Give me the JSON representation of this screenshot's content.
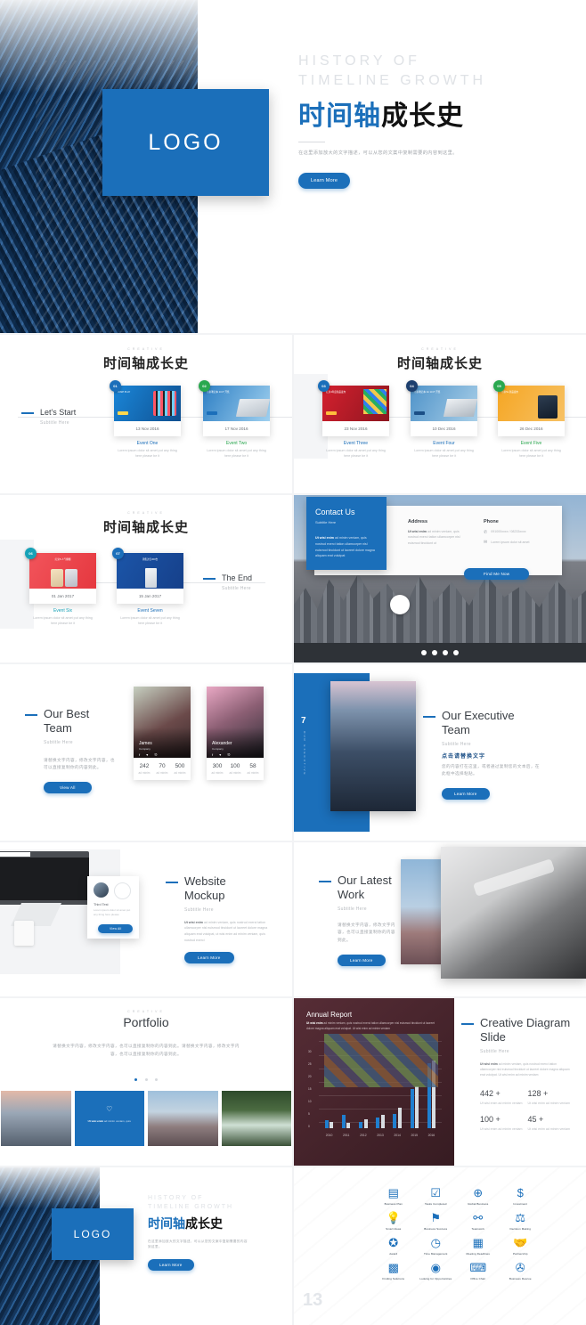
{
  "cover": {
    "en_line1": "HISTORY OF",
    "en_line2": "TIMELINE GROWTH",
    "cn_blue": "时间轴",
    "cn_black": "成长史",
    "desc": "在这里添加放大的文字描述，可以从您的文案中复制需要的内容到这里。",
    "button": "Learn More",
    "logo": "LOGO"
  },
  "timeline1": {
    "kicker": "CREATIVE",
    "title": "时间轴成长史",
    "start_label": "Let's Start",
    "start_sub": "Subtitle Here",
    "events": [
      {
        "num": "01",
        "date": "13 Nov 2016",
        "name": "Event One",
        "desc": "Lorem ipsum dolor sit amet put any thing here please be it",
        "color": "#1b6fba"
      },
      {
        "num": "02",
        "date": "17 Nov 2016",
        "name": "Event Two",
        "desc": "Lorem ipsum dolor sit amet put any thing here please be it",
        "color": "#2aa84f"
      }
    ]
  },
  "timeline2": {
    "kicker": "CREATIVE",
    "title": "时间轴成长史",
    "events": [
      {
        "num": "03",
        "date": "23 Nov 2016",
        "name": "Event Three",
        "desc": "Lorem ipsum dolor sit amet put any thing here please be it",
        "color": "#1b6fba"
      },
      {
        "num": "04",
        "date": "10 Dec 2016",
        "name": "Event Four",
        "desc": "Lorem ipsum dolor sit amet put any thing here please be it",
        "color": "#1d3f6e"
      },
      {
        "num": "05",
        "date": "26 Dec 2016",
        "name": "Event Five",
        "desc": "Lorem ipsum dolor sit amet put any thing here please be it",
        "color": "#2aa84f"
      }
    ]
  },
  "timeline3": {
    "kicker": "CREATIVE",
    "title": "时间轴成长史",
    "end_label": "The End",
    "end_sub": "Subtitle Here",
    "events": [
      {
        "num": "06",
        "date": "01 Jan 2017",
        "name": "Event Six",
        "desc": "Lorem ipsum dolor sit amet put any thing here please be it",
        "color": "#17a2b8"
      },
      {
        "num": "07",
        "date": "15 Jan 2017",
        "name": "Event Seven",
        "desc": "Lorem ipsum dolor sit amet put any thing here please be it",
        "color": "#1b6fba"
      }
    ]
  },
  "contact": {
    "title": "Contact Us",
    "subtitle": "Subtitle Here",
    "blurb_bold": "Ut wisi enim",
    "blurb": "ad minim veniam, quis nostrud exerci tation ullamcorper nisl euismod tincidunt ut laoreet dolore magna aliquam erat volutpat",
    "address_label": "Address",
    "address_bold": "Ut wisi enim",
    "address_text": "ad minim veniam, quis nostrud exerci tation ullamcorper nisl euismod tincidunt ut",
    "phone_label": "Phone",
    "phone_value": "091000xxxx / 08233xxxx",
    "mail_value": "Lorem ipsum dolor sit amet",
    "button": "Find Me Now"
  },
  "team": {
    "title_l1": "Our Best",
    "title_l2": "Team",
    "subtitle": "Subtitle Here",
    "desc": "请替换文字内容，修改文字内容，也可以直接复制你的内容到此。",
    "button": "View All",
    "members": [
      {
        "name": "James",
        "role": "Company",
        "stats": [
          {
            "n": "242",
            "l": "ad minim"
          },
          {
            "n": "70",
            "l": "ad minim"
          },
          {
            "n": "500",
            "l": "ad minim"
          }
        ]
      },
      {
        "name": "Alexander",
        "role": "Company",
        "stats": [
          {
            "n": "300",
            "l": "ad minim"
          },
          {
            "n": "100",
            "l": "ad minim"
          },
          {
            "n": "58",
            "l": "ad minim"
          }
        ]
      }
    ]
  },
  "executive": {
    "page_number": "7",
    "side_text": "OUR EXECUTIVE",
    "title_l1": "Our Executive",
    "title_l2": "Team",
    "subtitle": "Subtitle Here",
    "cn_heading": "点击请替换文字",
    "desc": "您的内容打在这里，或者通过复制您的文本后，在此框中选择粘贴。",
    "button": "Learn More"
  },
  "mockup": {
    "title_l1": "Website",
    "title_l2": "Mockup",
    "subtitle": "Subtitle Here",
    "desc_bold": "Ut wisi enim",
    "desc": "ad minim veniam, quis nostrud exerci tation ullamcorper nisl euismod tincidunt ut laoreet dolore magna aliquam erat volutpat, ut wisi enim ad minim veniam, quis nostrud exerci",
    "button": "Learn More",
    "card_title": "Third Test",
    "card_desc": "Lorem ipsum dolor sit amet put any thing here please",
    "card_button": "View All"
  },
  "latest_work": {
    "title_l1": "Our Latest",
    "title_l2": "Work",
    "subtitle": "Subtitle Here",
    "desc": "请替换文字内容，修改文字内容，也可以直接复制你的内容到此。",
    "button": "Learn More"
  },
  "portfolio": {
    "kicker": "CREATIVE",
    "title": "Portfolio",
    "desc": "请替换文字内容，修改文字内容，也可以直接复制你的内容到此。请替换文字内容，修改文字内容，也可以直接复制你的内容到此。",
    "heart_caption_bold": "Ut wisi enim",
    "heart_caption": "ad minim veniam, quis"
  },
  "diagram": {
    "report_title": "Annual Report",
    "report_bold": "Ut wisi enim",
    "report_desc": "ad minim veniam, quis nostrud exerci tation ullamcorper nisl euismod tincidunt ut laoreet dolore magna aliquam erat volutpat. Ut wisi enim ad minim veniam",
    "title_l1": "Creative Diagram",
    "title_l2": "Slide",
    "subtitle": "Subtitle Here",
    "desc_bold": "Ut wisi enim",
    "desc": "ad minim veniam, quis nostrud exerci tation ullamcorper nisl euismod tincidunt ut laoreet dolore magna aliquam erat volutpat. Ut wisi enim ad minim veniam",
    "stats": [
      {
        "value": "442 +",
        "label": "Ut wisi enim ad minim veniam"
      },
      {
        "value": "128 +",
        "label": "Ut wisi enim ad minim veniam"
      },
      {
        "value": "100 +",
        "label": "Ut wisi enim ad minim veniam"
      },
      {
        "value": "45 +",
        "label": "Ut wisi enim ad minim veniam"
      }
    ]
  },
  "chart_data": {
    "type": "bar",
    "title": "Annual Report",
    "categories": [
      "2010",
      "2011",
      "2012",
      "2013",
      "2014",
      "2015",
      "2016"
    ],
    "series": [
      {
        "name": "Series 1",
        "color": "#1f7fd0",
        "values": [
          3,
          5,
          2.5,
          4,
          5.5,
          15,
          25
        ]
      },
      {
        "name": "Series 2",
        "color": "#d8dde2",
        "values": [
          2.5,
          2,
          3.5,
          5,
          8,
          16,
          26
        ]
      }
    ],
    "ylim": [
      0,
      30
    ],
    "yticks": [
      0,
      5,
      10,
      15,
      20,
      25,
      30
    ],
    "xlabel": "",
    "ylabel": "",
    "grid": true,
    "legend": "none"
  },
  "closing": {
    "en_line1": "HISTORY OF",
    "en_line2": "TIMELINE GROWTH",
    "cn_blue": "时间轴",
    "cn_black": "成长史",
    "desc": "在这里添加放大的文字描述，可以从您的文案中复制需要的内容到这里。",
    "button": "Learn More",
    "logo": "LOGO"
  },
  "icons": {
    "page_number": "13",
    "items": [
      {
        "glyph": "▤",
        "label": "Business Plan",
        "name": "business-plan-icon"
      },
      {
        "glyph": "☑",
        "label": "Tasks Completed",
        "name": "tasks-completed-icon"
      },
      {
        "glyph": "⊕",
        "label": "Global Business",
        "name": "global-business-icon"
      },
      {
        "glyph": "$",
        "label": "Investment",
        "name": "investment-icon"
      },
      {
        "glyph": "💡",
        "label": "Smart Ideas",
        "name": "smart-ideas-icon"
      },
      {
        "glyph": "⚑",
        "label": "Business Success",
        "name": "business-success-icon"
      },
      {
        "glyph": "⚯",
        "label": "Teamwork",
        "name": "teamwork-icon"
      },
      {
        "glyph": "⚖",
        "label": "Decision Making",
        "name": "decision-making-icon"
      },
      {
        "glyph": "✪",
        "label": "Award",
        "name": "award-icon"
      },
      {
        "glyph": "◷",
        "label": "Time Management",
        "name": "time-management-icon"
      },
      {
        "glyph": "▦",
        "label": "Meeting Deadlines",
        "name": "meeting-deadlines-icon"
      },
      {
        "glyph": "🤝",
        "label": "Partnership",
        "name": "partnership-icon"
      },
      {
        "glyph": "▩",
        "label": "Finding Solutions",
        "name": "finding-solutions-icon"
      },
      {
        "glyph": "◉",
        "label": "Looking for Opportunities",
        "name": "looking-for-opportunities-icon"
      },
      {
        "glyph": "⌨",
        "label": "Office Chair",
        "name": "office-chair-icon"
      },
      {
        "glyph": "✇",
        "label": "Business Rescue",
        "name": "business-rescue-icon"
      }
    ]
  },
  "colors": {
    "accent": "#1b6fba",
    "green": "#2aa84f",
    "dark": "#2e3237"
  }
}
